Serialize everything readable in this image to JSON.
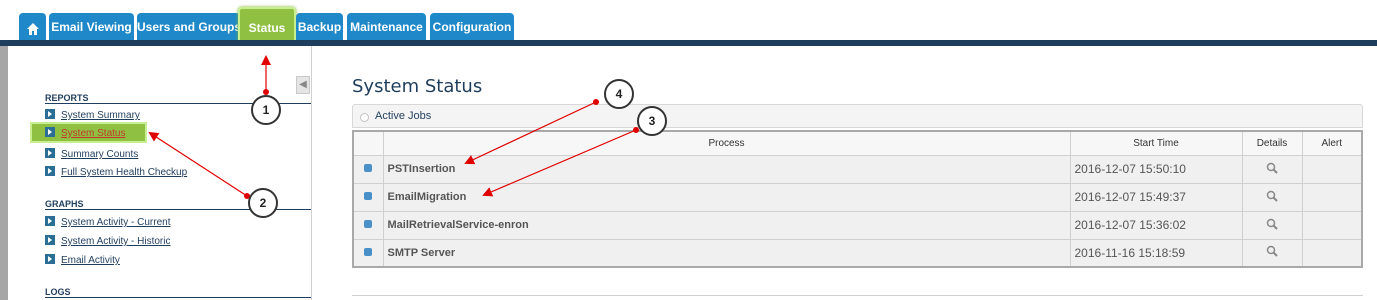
{
  "tabs": [
    {
      "label": "Email Viewing"
    },
    {
      "label": "Users and Groups"
    },
    {
      "label": "Status"
    },
    {
      "label": "Backup"
    },
    {
      "label": "Maintenance"
    },
    {
      "label": "Configuration"
    }
  ],
  "sidebar": {
    "reports_heading": "REPORTS",
    "reports": [
      "System Summary",
      "System Status",
      "Summary Counts",
      "Full System Health Checkup"
    ],
    "graphs_heading": "GRAPHS",
    "graphs": [
      "System Activity - Current",
      "System Activity - Historic",
      "Email Activity"
    ],
    "logs_heading": "LOGS",
    "collapse_glyph": "◀"
  },
  "main": {
    "title": "System Status",
    "jobs_header": "Active Jobs",
    "columns": [
      "Process",
      "Start Time",
      "Details",
      "Alert"
    ],
    "rows": [
      {
        "process": "PSTInsertion",
        "start": "2016-12-07 15:50:10"
      },
      {
        "process": "EmailMigration",
        "start": "2016-12-07 15:49:37"
      },
      {
        "process": "MailRetrievalService-enron",
        "start": "2016-12-07 15:36:02"
      },
      {
        "process": "SMTP Server",
        "start": "2016-11-16 15:18:59"
      }
    ]
  },
  "callouts": [
    "1",
    "2",
    "3",
    "4"
  ],
  "colors": {
    "accent": "#1e88c8",
    "active_tab": "#8fc042",
    "annotation": "#e00000",
    "nav_bar": "#1f3d5c"
  }
}
